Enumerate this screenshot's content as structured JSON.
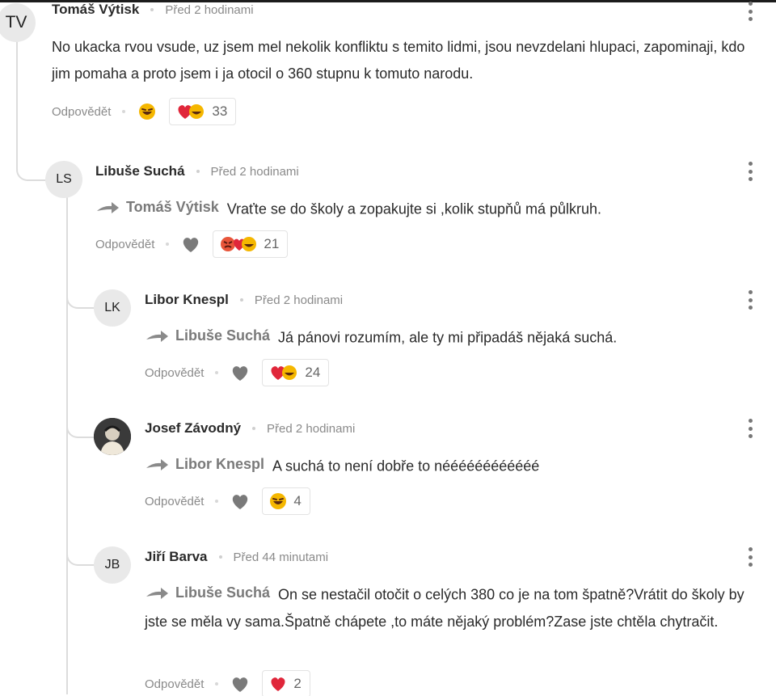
{
  "comments": [
    {
      "initials": "TV",
      "author": "Tomáš Výtisk",
      "time": "Před 2 hodinami",
      "reply_to": "",
      "text": "No ukacka rvou vsude, uz jsem mel nekolik konfliktu s temito lidmi, jsou nevzdelani hlupaci, zapominaji, kdo jim pomaha a proto jsem i ja otocil o 360 stupnu k tomuto narodu.",
      "reply_label": "Odpovědět",
      "reaction_count": "33",
      "reaction_icons": [
        "heart",
        "laugh"
      ]
    },
    {
      "initials": "LS",
      "author": "Libuše Suchá",
      "time": "Před 2 hodinami",
      "reply_to": "Tomáš Výtisk",
      "text": "Vraťte se do školy a zopakujte si ,kolik stupňů má půlkruh.",
      "reply_label": "Odpovědět",
      "reaction_count": "21",
      "reaction_icons": [
        "angry",
        "heart",
        "laugh"
      ]
    },
    {
      "initials": "LK",
      "author": "Libor Knespl",
      "time": "Před 2 hodinami",
      "reply_to": "Libuše Suchá",
      "text": "Já pánovi rozumím, ale ty mi připadáš nějaká suchá.",
      "reply_label": "Odpovědět",
      "reaction_count": "24",
      "reaction_icons": [
        "heart",
        "laugh"
      ]
    },
    {
      "initials": "",
      "author": "Josef Závodný",
      "time": "Před 2 hodinami",
      "reply_to": "Libor Knespl",
      "text": "A suchá to není dobře to néééééééééééé",
      "reply_label": "Odpovědět",
      "reaction_count": "4",
      "reaction_icons": [
        "laugh"
      ]
    },
    {
      "initials": "JB",
      "author": "Jiří Barva",
      "time": "Před 44 minutami",
      "reply_to": "Libuše Suchá",
      "text": "On se nestačil otočit o celých 380 co je na tom špatně?Vrátit do školy by jste se měla vy sama.Špatně chápete ,to máte nějaký problém?Zase jste chtěla chytračit.",
      "reply_label": "Odpovědět",
      "reaction_count": "2",
      "reaction_icons": [
        "heart"
      ]
    }
  ],
  "colors": {
    "heart": "#e0263a",
    "laugh": "#f5b700",
    "angry": "#e8553a",
    "line": "#dcdcdc"
  }
}
